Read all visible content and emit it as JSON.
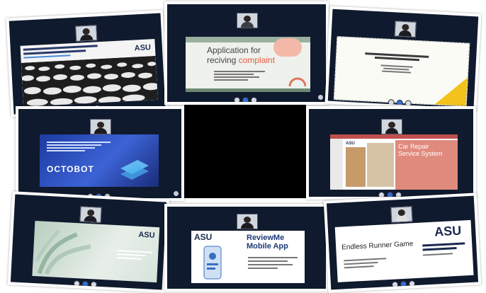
{
  "tiles": [
    {
      "id": "t1",
      "slide_title": "",
      "asu": "ASU"
    },
    {
      "id": "t2",
      "slide_title_line1": "Application for",
      "slide_title_line2a": "reciving ",
      "slide_title_line2b": "complaint"
    },
    {
      "id": "t3",
      "slide_title": ""
    },
    {
      "id": "t4",
      "slide_title": "OCTOBOT"
    },
    {
      "id": "t5",
      "slide_title": "Car Repair Service System"
    },
    {
      "id": "t6",
      "asu": "ASU"
    },
    {
      "id": "t7",
      "asu": "ASU",
      "slide_title_line1": "ReviewMe",
      "slide_title_line2": "Mobile App"
    },
    {
      "id": "t8",
      "asu": "ASU",
      "slide_title": "Endless Runner Game"
    }
  ],
  "colors": {
    "accent": "#e65c45",
    "dark": "#0f1a2e"
  }
}
